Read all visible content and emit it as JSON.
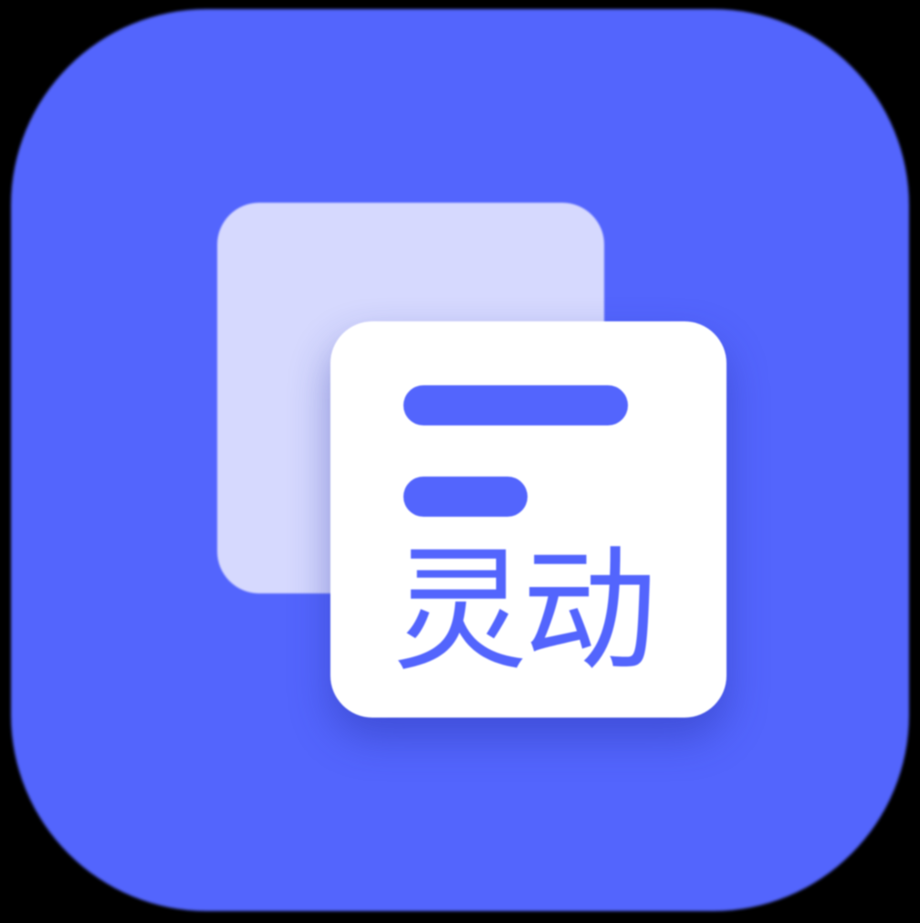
{
  "icon": {
    "name": "lingdong-app-icon",
    "text": "灵动",
    "colors": {
      "background": "#000000",
      "accent": "#5365fd",
      "back_card": "#d6d9fe",
      "front_card": "#ffffff"
    }
  }
}
